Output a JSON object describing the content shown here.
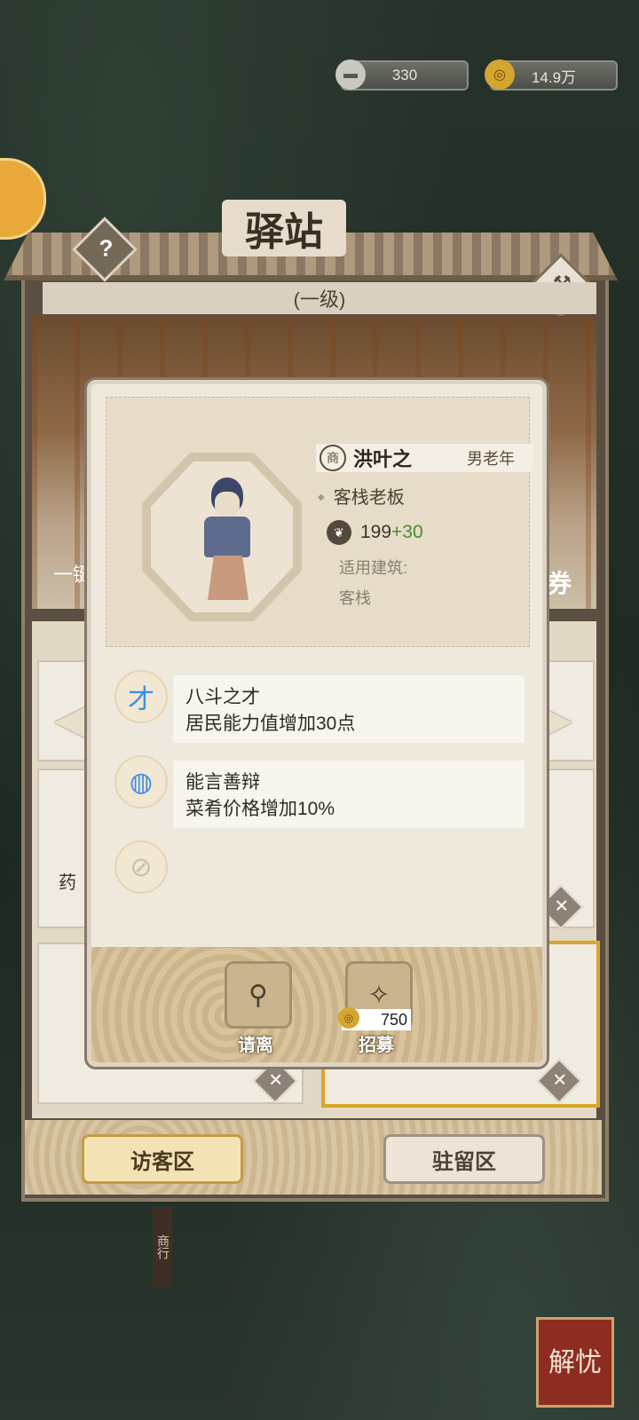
{
  "resources": {
    "silver": "330",
    "coins": "14.9万"
  },
  "building": {
    "title": "驿站",
    "level": "(一级)",
    "help": "?"
  },
  "background_peek": {
    "left_text": "一键",
    "right_text": "券",
    "slot_label": "药"
  },
  "tabs": {
    "visitor": "访客区",
    "resident": "驻留区"
  },
  "character": {
    "name": "洪叶之",
    "name_badge": "商",
    "gender_age": "男老年",
    "occupation": "客栈老板",
    "ability_base": "199",
    "ability_bonus": "+30",
    "building_label": "适用建筑:",
    "building_value": "客栈"
  },
  "skills": [
    {
      "name": "八斗之才",
      "desc": "居民能力值增加30点",
      "icon": "brush-stroke-icon"
    },
    {
      "name": "能言善辩",
      "desc": "菜肴价格增加10%",
      "icon": "dumpling-plate-icon"
    },
    {
      "name": "",
      "desc": "",
      "icon": "empty-slot-icon"
    }
  ],
  "actions": {
    "dismiss": "请离",
    "recruit": "招募",
    "recruit_cost": "750"
  },
  "map": {
    "shop_sign": "商行",
    "stamp": "解忧"
  },
  "colors": {
    "bonus_green": "#4e8b2d",
    "selected_slot": "#d9a62a",
    "skill_icon_blue": "#3b8fe0"
  }
}
